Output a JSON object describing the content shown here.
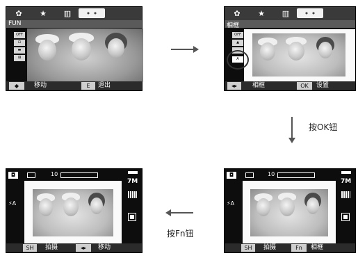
{
  "screen1": {
    "menu_title": "FUN",
    "side_items": [
      "OFF",
      "⊡",
      "▬",
      "⚅"
    ],
    "bottom": {
      "move_btn": "◆",
      "move_label": "移动",
      "exit_btn": "E",
      "exit_label": "退出"
    }
  },
  "screen2": {
    "menu_title": "相框",
    "side_items": [
      "OFF",
      "▲",
      "",
      "A"
    ],
    "bottom": {
      "frame_btn": "◂▸",
      "frame_label": "相框",
      "ok_btn": "OK",
      "ok_label": "设置"
    }
  },
  "screen3": {
    "counter": "10",
    "right_label": "7M",
    "flash": "⚡A",
    "bottom": {
      "shoot_btn": "SH",
      "shoot_label": "拍摄",
      "move_btn": "◂▸",
      "move_label": "移动"
    }
  },
  "screen4": {
    "counter": "10",
    "right_label": "7M",
    "flash": "⚡A",
    "bottom": {
      "shoot_btn": "SH",
      "shoot_label": "拍摄",
      "fn_btn": "Fn",
      "fn_label": "相框"
    }
  },
  "captions": {
    "ok_step": "按OK钮",
    "fn_step": "按Fn钮"
  },
  "colors": {
    "bar": "#2b2b2b",
    "button": "#cfcfcf"
  }
}
